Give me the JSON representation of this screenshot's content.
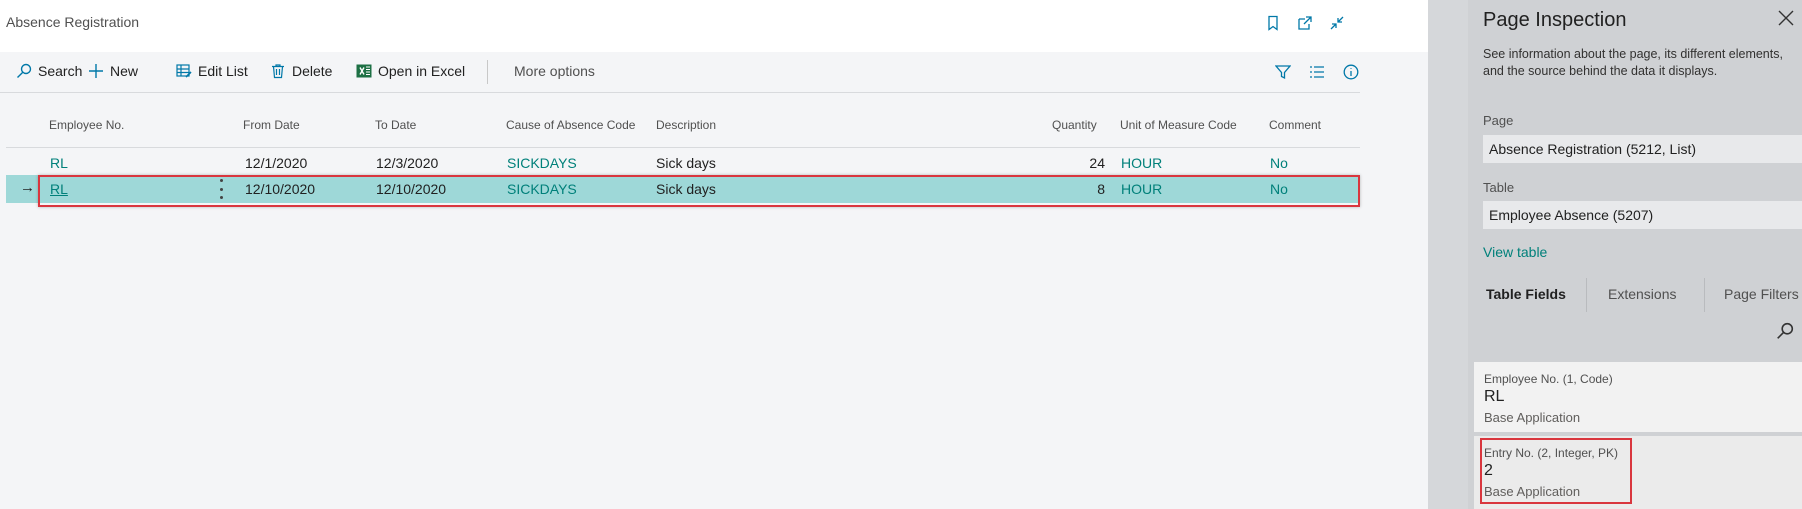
{
  "page": {
    "title": "Absence Registration"
  },
  "actions": {
    "search": "Search",
    "new": "New",
    "edit_list": "Edit List",
    "delete": "Delete",
    "open_in_excel": "Open in Excel",
    "more_options": "More options"
  },
  "columns": {
    "employee_no": "Employee No.",
    "from_date": "From Date",
    "to_date": "To Date",
    "cause": "Cause of Absence Code",
    "description": "Description",
    "quantity": "Quantity",
    "uom": "Unit of Measure Code",
    "comment": "Comment"
  },
  "rows": [
    {
      "employee_no": "RL",
      "from_date": "12/1/2020",
      "to_date": "12/3/2020",
      "cause": "SICKDAYS",
      "description": "Sick days",
      "quantity": "24",
      "uom": "HOUR",
      "comment": "No"
    },
    {
      "employee_no": "RL",
      "from_date": "12/10/2020",
      "to_date": "12/10/2020",
      "cause": "SICKDAYS",
      "description": "Sick days",
      "quantity": "8",
      "uom": "HOUR",
      "comment": "No",
      "row_marker": "→"
    }
  ],
  "inspection": {
    "title": "Page Inspection",
    "description": "See information about the page, its different elements, and the source behind the data it displays.",
    "page_label": "Page",
    "page_value": "Absence Registration (5212, List)",
    "table_label": "Table",
    "table_value": "Employee Absence (5207)",
    "view_table": "View table",
    "tabs": [
      "Table Fields",
      "Extensions",
      "Page Filters"
    ],
    "fields": [
      {
        "caption": "Employee No. (1, Code)",
        "value": "RL",
        "source": "Base Application"
      },
      {
        "caption": "Entry No. (2, Integer, PK)",
        "value": "2",
        "source": "Base Application"
      }
    ]
  },
  "colors": {
    "accent": "#00807a",
    "selected_row": "#9ed8d8",
    "highlight": "#d9363e"
  }
}
